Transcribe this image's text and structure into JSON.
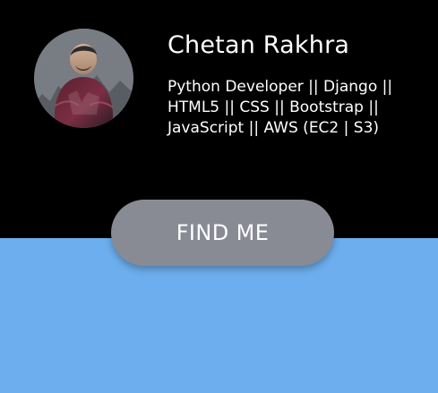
{
  "profile": {
    "name": "Chetan Rakhra",
    "bio": "Python Developer || Django || HTML5 || CSS || Bootstrap || JavaScript || AWS (EC2 | S3)"
  },
  "cta": {
    "label": "FIND ME"
  },
  "colors": {
    "top_background": "#000000",
    "bottom_background": "#6daeee",
    "button_background": "#898b94",
    "text": "#ffffff"
  },
  "icons": {
    "avatar": "profile-photo"
  }
}
